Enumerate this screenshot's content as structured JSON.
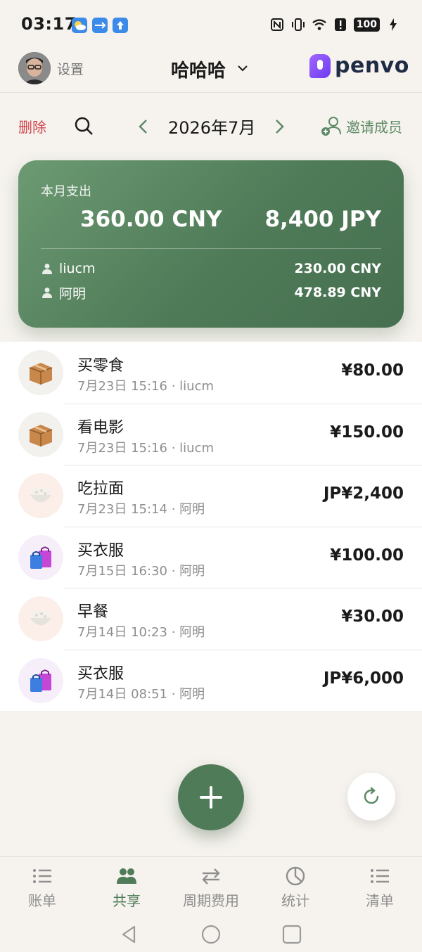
{
  "status_bar": {
    "time": "03:17",
    "icons": [
      "weather-icon",
      "usb-icon",
      "upload-icon",
      "nfc-icon",
      "vibrate-icon",
      "wifi-icon",
      "alert-icon",
      "battery-icon"
    ],
    "battery": "100"
  },
  "header": {
    "settings_label": "设置",
    "ledger_name": "哈哈哈",
    "brand": "penvo"
  },
  "toolbar": {
    "delete_label": "删除",
    "month": "2026年7月",
    "invite_label": "邀请成员"
  },
  "summary": {
    "label": "本月支出",
    "total_cny": "360.00 CNY",
    "total_jpy": "8,400 JPY",
    "members": [
      {
        "name": "liucm",
        "amount": "230.00 CNY"
      },
      {
        "name": "阿明",
        "amount": "478.89 CNY"
      }
    ]
  },
  "transactions": [
    {
      "title": "买零食",
      "date": "7月23日 15:16",
      "member": "liucm",
      "amount": "¥80.00",
      "icon": "package-icon"
    },
    {
      "title": "看电影",
      "date": "7月23日 15:16",
      "member": "liucm",
      "amount": "¥150.00",
      "icon": "package-icon"
    },
    {
      "title": "吃拉面",
      "date": "7月23日 15:14",
      "member": "阿明",
      "amount": "JP¥2,400",
      "icon": "rice-bowl-icon"
    },
    {
      "title": "买衣服",
      "date": "7月15日 16:30",
      "member": "阿明",
      "amount": "¥100.00",
      "icon": "shopping-bags-icon"
    },
    {
      "title": "早餐",
      "date": "7月14日 10:23",
      "member": "阿明",
      "amount": "¥30.00",
      "icon": "rice-bowl-icon"
    },
    {
      "title": "买衣服",
      "date": "7月14日 08:51",
      "member": "阿明",
      "amount": "JP¥6,000",
      "icon": "shopping-bags-icon"
    }
  ],
  "separator": "·",
  "bottom_nav": [
    {
      "label": "账单",
      "icon": "list-icon",
      "active": false
    },
    {
      "label": "共享",
      "icon": "people-icon",
      "active": true
    },
    {
      "label": "周期费用",
      "icon": "repeat-icon",
      "active": false
    },
    {
      "label": "统计",
      "icon": "pie-chart-icon",
      "active": false
    },
    {
      "label": "清单",
      "icon": "checklist-icon",
      "active": false
    }
  ],
  "colors": {
    "accent": "#4f7b58",
    "danger": "#d0454c",
    "background": "#f6f3ee"
  }
}
